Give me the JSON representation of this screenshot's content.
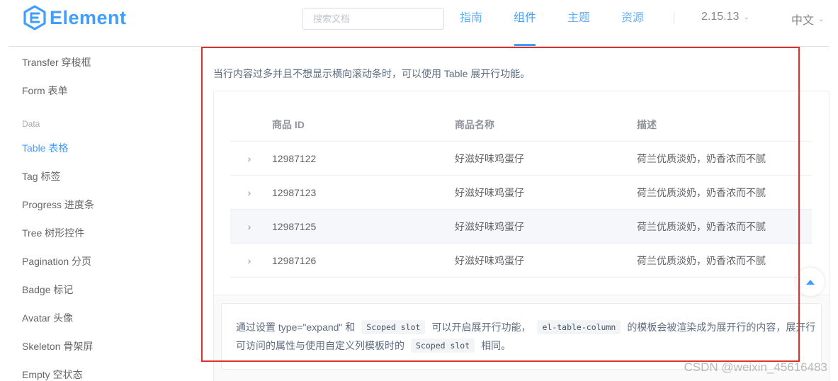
{
  "header": {
    "logo_text": "Element",
    "search_placeholder": "搜索文档",
    "nav": [
      {
        "label": "指南"
      },
      {
        "label": "组件"
      },
      {
        "label": "主题"
      },
      {
        "label": "资源"
      }
    ],
    "active_nav": "组件",
    "version": "2.15.13",
    "language": "中文",
    "accent_color": "#409eff"
  },
  "sidebar": {
    "items_top": [
      {
        "label": "Transfer 穿梭框"
      },
      {
        "label": "Form 表单"
      }
    ],
    "group_label": "Data",
    "items": [
      {
        "label": "Table 表格",
        "active": true
      },
      {
        "label": "Tag 标签"
      },
      {
        "label": "Progress 进度条"
      },
      {
        "label": "Tree 树形控件"
      },
      {
        "label": "Pagination 分页"
      },
      {
        "label": "Badge 标记"
      },
      {
        "label": "Avatar 头像"
      },
      {
        "label": "Skeleton 骨架屏"
      },
      {
        "label": "Empty 空状态"
      }
    ]
  },
  "main": {
    "description": "当行内容过多并且不想显示横向滚动条时，可以使用 Table 展开行功能。",
    "table": {
      "columns": [
        "商品 ID",
        "商品名称",
        "描述"
      ],
      "rows": [
        {
          "id": "12987122",
          "name": "好滋好味鸡蛋仔",
          "desc": "荷兰优质淡奶，奶香浓而不腻"
        },
        {
          "id": "12987123",
          "name": "好滋好味鸡蛋仔",
          "desc": "荷兰优质淡奶，奶香浓而不腻"
        },
        {
          "id": "12987125",
          "name": "好滋好味鸡蛋仔",
          "desc": "荷兰优质淡奶，奶香浓而不腻"
        },
        {
          "id": "12987126",
          "name": "好滋好味鸡蛋仔",
          "desc": "荷兰优质淡奶，奶香浓而不腻"
        }
      ]
    },
    "tip": {
      "line1_a": "通过设置 type=\"expand\" 和",
      "code1": "Scoped slot",
      "line1_b": "可以开启展开行功能，",
      "code2": "el-table-column",
      "line1_c": "的模板会被渲染成为展开行的内容，展开行",
      "line2_a": "可访问的属性与使用自定义列模板时的",
      "code3": "Scoped slot",
      "line2_b": "相同。"
    }
  },
  "watermark": "CSDN @weixin_45616483",
  "annotation_color": "#e0302a"
}
